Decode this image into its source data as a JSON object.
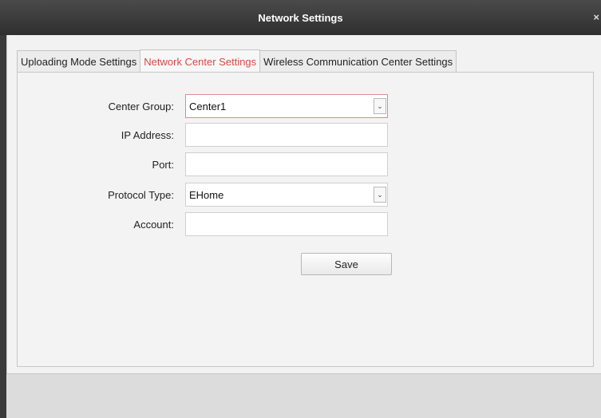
{
  "window": {
    "title": "Network Settings",
    "close_icon": "×"
  },
  "tabs": [
    {
      "label": "Uploading Mode Settings",
      "active": false
    },
    {
      "label": "Network Center Settings",
      "active": true
    },
    {
      "label": "Wireless Communication Center Settings",
      "active": false
    }
  ],
  "form": {
    "center_group": {
      "label": "Center Group:",
      "value": "Center1"
    },
    "ip_address": {
      "label": "IP Address:",
      "value": ""
    },
    "port": {
      "label": "Port:",
      "value": ""
    },
    "protocol_type": {
      "label": "Protocol Type:",
      "value": "EHome"
    },
    "account": {
      "label": "Account:",
      "value": ""
    },
    "dropdown_glyph": "⌄",
    "save_label": "Save"
  },
  "colors": {
    "active_tab_text": "#d64a4a",
    "titlebar": "#3a3a3a"
  }
}
